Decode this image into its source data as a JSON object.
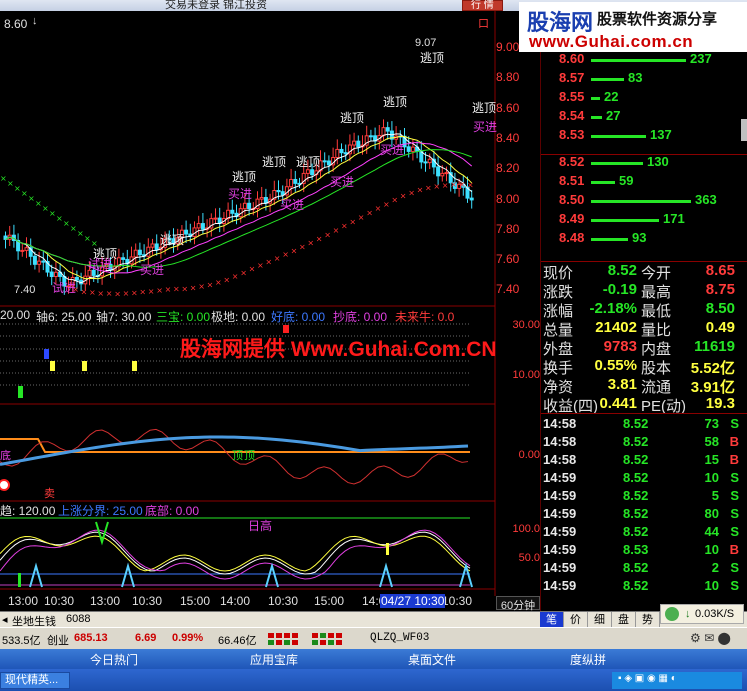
{
  "window": {
    "title": "交易未登录 锦江投资",
    "trade_button": "行 情"
  },
  "watermark_top": {
    "logo_cn": "股海网",
    "logo_tag": "股票软件资源分享",
    "url": "www.Guhai.com.cn"
  },
  "watermark_mid": "股海网提供 Www.Guhai.Com.CN",
  "main_chart": {
    "top_left_price": "8.60",
    "box_icon": "口",
    "y_axis": [
      "9.00",
      "8.80",
      "8.60",
      "8.40",
      "8.20",
      "8.00",
      "7.80",
      "7.60",
      "7.40"
    ],
    "high_label": "9.07",
    "low_label": "7.40",
    "annotations": {
      "top_label": "逃顶",
      "buy_label": "买进",
      "alt_label": "试进"
    }
  },
  "indicator1": {
    "labels": [
      {
        "text": "20.00",
        "color": "#e0e0e0"
      },
      {
        "text": "轴6: 25.00",
        "color": "#e0e0e0"
      },
      {
        "text": "轴7: 30.00",
        "color": "#e0e0e0"
      },
      {
        "text": "三宝: 0.00",
        "color": "#26e626"
      },
      {
        "text": "极地: 0.00",
        "color": "#e0e0e0"
      },
      {
        "text": "好底: 0.00",
        "color": "#3c78ff"
      },
      {
        "text": "抄底: 0.00",
        "color": "#e040e0"
      },
      {
        "text": "未来牛: 0.0",
        "color": "#ff3b3b"
      }
    ],
    "y_axis": [
      "30.00",
      "10.00"
    ]
  },
  "indicator2": {
    "y_axis": [
      "0.00"
    ],
    "labels": {
      "ding": "顶",
      "di": "底",
      "mai": "卖"
    }
  },
  "indicator3": {
    "labels": [
      {
        "text": "趋: 120.00",
        "color": "#e0e0e0"
      },
      {
        "text": "上涨分界: 25.00",
        "color": "#3c78ff"
      },
      {
        "text": "底部: 0.00",
        "color": "#e040e0"
      }
    ],
    "y_axis": [
      "100.0",
      "50.0"
    ],
    "annotation": "日高"
  },
  "x_axis": {
    "ticks": [
      "13:00",
      "10:30",
      "13:00",
      "10:30",
      "15:00",
      "14:00",
      "10:30",
      "15:00",
      "14:00",
      "10:30"
    ],
    "highlight": "04/27 10:30",
    "period": "60分钟"
  },
  "order_book": {
    "asks": [
      {
        "price": "8.60",
        "vol": "237",
        "bar": 0.95
      },
      {
        "price": "8.57",
        "vol": "83",
        "bar": 0.33
      },
      {
        "price": "8.55",
        "vol": "22",
        "bar": 0.09
      },
      {
        "price": "8.54",
        "vol": "27",
        "bar": 0.11
      },
      {
        "price": "8.53",
        "vol": "137",
        "bar": 0.55
      }
    ],
    "bids": [
      {
        "price": "8.52",
        "vol": "130",
        "bar": 0.52
      },
      {
        "price": "8.51",
        "vol": "59",
        "bar": 0.24
      },
      {
        "price": "8.50",
        "vol": "363",
        "bar": 1.0
      },
      {
        "price": "8.49",
        "vol": "171",
        "bar": 0.68
      },
      {
        "price": "8.48",
        "vol": "93",
        "bar": 0.37
      }
    ]
  },
  "quote": [
    {
      "l1": "现价",
      "v1": "8.52",
      "c1": "#26e626",
      "l2": "今开",
      "v2": "8.65",
      "c2": "#ff3b3b"
    },
    {
      "l1": "涨跌",
      "v1": "-0.19",
      "c1": "#26e626",
      "l2": "最高",
      "v2": "8.75",
      "c2": "#ff3b3b"
    },
    {
      "l1": "涨幅",
      "v1": "-2.18%",
      "c1": "#26e626",
      "l2": "最低",
      "v2": "8.50",
      "c2": "#26e626"
    },
    {
      "l1": "总量",
      "v1": "21402",
      "c1": "#ffff40",
      "l2": "量比",
      "v2": "0.49",
      "c2": "#ffff40"
    },
    {
      "l1": "外盘",
      "v1": "9783",
      "c1": "#ff3b3b",
      "l2": "内盘",
      "v2": "11619",
      "c2": "#26e626"
    },
    {
      "l1": "换手",
      "v1": "0.55%",
      "c1": "#ffff40",
      "l2": "股本",
      "v2": "5.52亿",
      "c2": "#ffff40"
    },
    {
      "l1": "净资",
      "v1": "3.81",
      "c1": "#ffff40",
      "l2": "流通",
      "v2": "3.91亿",
      "c2": "#ffff40"
    },
    {
      "l1": "收益(四)",
      "v1": "0.441",
      "c1": "#ffff40",
      "l2": "PE(动)",
      "v2": "19.3",
      "c2": "#ffff40"
    }
  ],
  "ticks": [
    {
      "time": "14:58",
      "price": "8.52",
      "vol": "73",
      "side": "S",
      "side_color": "#26e626"
    },
    {
      "time": "14:58",
      "price": "8.52",
      "vol": "58",
      "side": "B",
      "side_color": "#ff3b3b"
    },
    {
      "time": "14:58",
      "price": "8.52",
      "vol": "15",
      "side": "B",
      "side_color": "#ff3b3b"
    },
    {
      "time": "14:59",
      "price": "8.52",
      "vol": "10",
      "side": "S",
      "side_color": "#26e626"
    },
    {
      "time": "14:59",
      "price": "8.52",
      "vol": "5",
      "side": "S",
      "side_color": "#26e626"
    },
    {
      "time": "14:59",
      "price": "8.52",
      "vol": "80",
      "side": "S",
      "side_color": "#26e626"
    },
    {
      "time": "14:59",
      "price": "8.52",
      "vol": "44",
      "side": "S",
      "side_color": "#26e626"
    },
    {
      "time": "14:59",
      "price": "8.53",
      "vol": "10",
      "side": "B",
      "side_color": "#ff3b3b"
    },
    {
      "time": "14:59",
      "price": "8.52",
      "vol": "2",
      "side": "S",
      "side_color": "#26e626"
    },
    {
      "time": "14:59",
      "price": "8.52",
      "vol": "10",
      "side": "S",
      "side_color": "#26e626"
    }
  ],
  "panel_tabs": [
    "笔",
    "价",
    "细",
    "盘",
    "势"
  ],
  "speed": "0.03K/S",
  "bottom_tab": "坐地生钱",
  "bottom_num": "6088",
  "status": {
    "amount": "533.5亿",
    "board": "创业",
    "board_val": "685.13",
    "change": "6.69",
    "pct": "0.99%",
    "vol": "66.46亿",
    "code": "QLZQ_WF03"
  },
  "quickbar": [
    "今日热门",
    "应用宝库",
    "桌面文件",
    "度纵拼"
  ],
  "taskbar_item": "现代精英..."
}
